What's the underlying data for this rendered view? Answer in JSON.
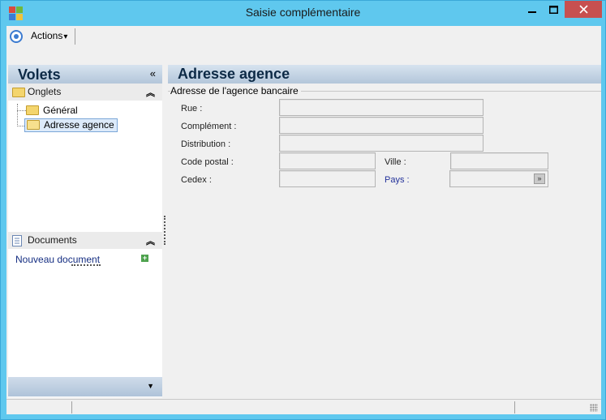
{
  "window": {
    "title": "Saisie complémentaire",
    "min_glyph": "—",
    "max_glyph": "☐",
    "close_glyph": "✕"
  },
  "toolbar": {
    "actions_label": "Actions",
    "actions_arrow": "▾"
  },
  "volets": {
    "title": "Volets",
    "collapse_glyph": "«",
    "onglets": {
      "label": "Onglets",
      "chevron": "︽",
      "items": [
        {
          "label": "Général"
        },
        {
          "label": "Adresse agence",
          "selected": true
        }
      ]
    },
    "documents": {
      "label": "Documents",
      "chevron": "︽",
      "new_doc": "Nouveau document"
    }
  },
  "main": {
    "title": "Adresse agence",
    "group_title": "Adresse de l'agence bancaire",
    "fields": {
      "rue": {
        "label": "Rue :",
        "value": ""
      },
      "complement": {
        "label": "Complément :",
        "value": ""
      },
      "distribution": {
        "label": "Distribution :",
        "value": ""
      },
      "code_postal": {
        "label": "Code postal :",
        "value": ""
      },
      "ville": {
        "label": "Ville :",
        "value": ""
      },
      "cedex": {
        "label": "Cedex :",
        "value": ""
      },
      "pays": {
        "label": "Pays :",
        "value": ""
      }
    }
  },
  "colors": {
    "title_bar": "#5fc8ee",
    "close_button": "#c75050",
    "pane_header": "#b3c6da",
    "link": "#152e82",
    "pays_label": "#22319a"
  },
  "icons": [
    "app-icon",
    "actions-icon",
    "collapse-icon",
    "folder-icon",
    "open-folder-icon",
    "document-icon",
    "add-icon",
    "dropdown-icon",
    "resize-grip-icon"
  ]
}
